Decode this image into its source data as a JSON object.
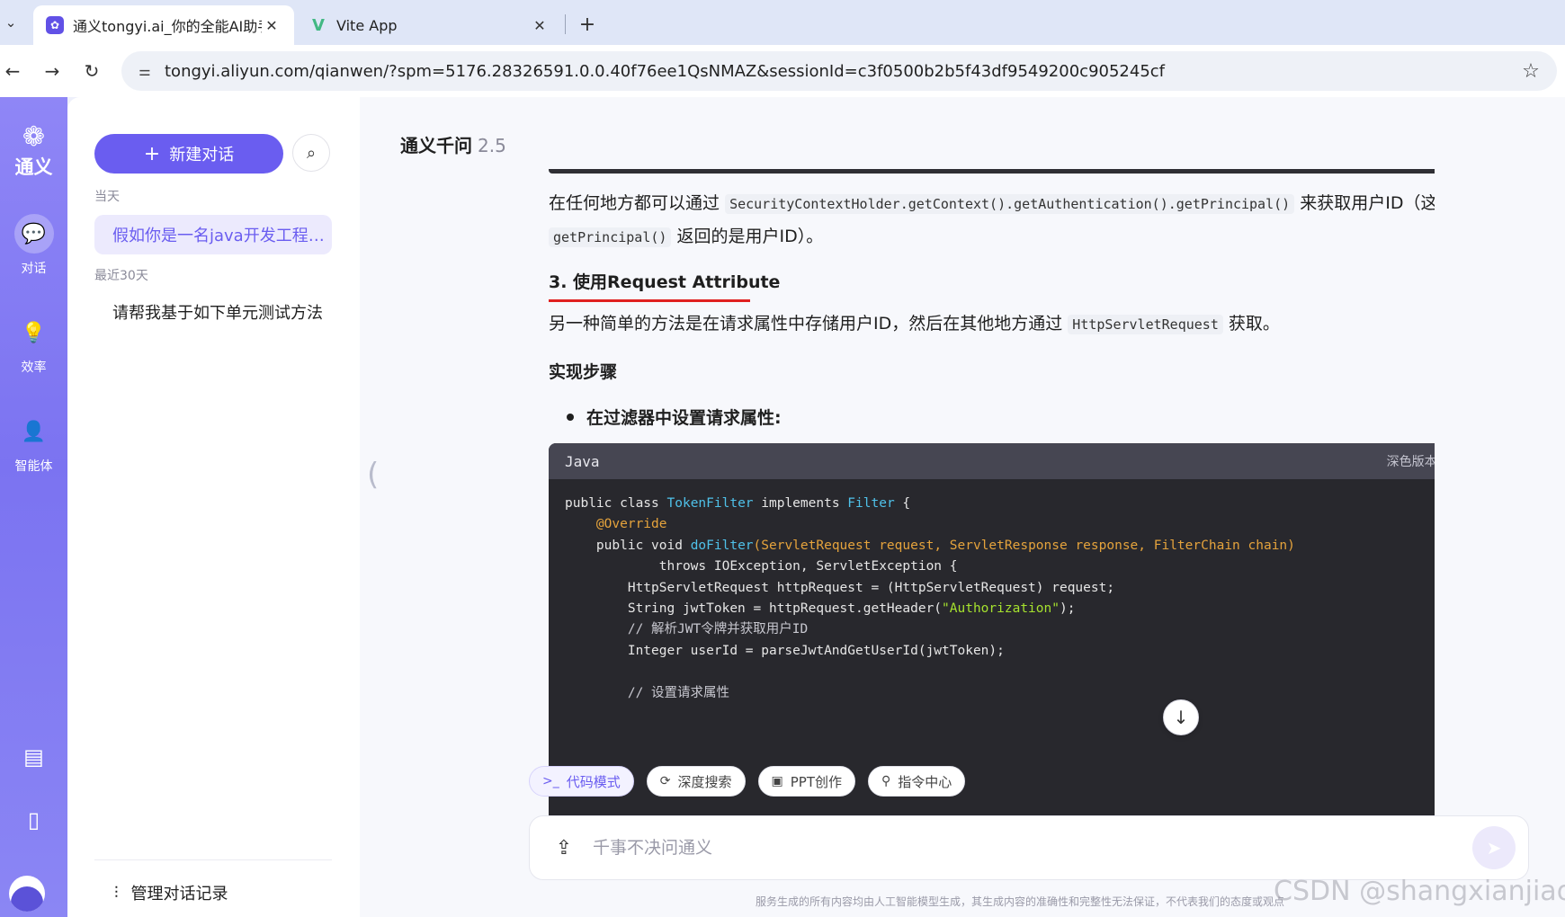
{
  "browser": {
    "tabs": [
      {
        "title": "通义tongyi.ai_你的全能AI助手",
        "close": "✕"
      },
      {
        "title": "Vite App",
        "close": "✕"
      }
    ],
    "new_tab": "+",
    "url": "tongyi.aliyun.com/qianwen/?spm=5176.28326591.0.0.40f76ee1QsNMAZ&sessionId=c3f0500b2b5f43df9549200c905245cf",
    "icons": [
      "tab-list-icon",
      "back-arrow-icon",
      "forward-arrow-icon",
      "reload-icon",
      "site-settings-icon",
      "bookmark-star-icon"
    ]
  },
  "rail": {
    "logo_text": "通义",
    "items": [
      {
        "label": "对话",
        "icon": "chat-bubble-icon",
        "active": true
      },
      {
        "label": "效率",
        "icon": "lightbulb-icon",
        "active": false
      },
      {
        "label": "智能体",
        "icon": "agent-icon",
        "active": false
      }
    ],
    "bottom_icons": [
      "document-icon",
      "tablet-icon",
      "avatar"
    ]
  },
  "sidebar": {
    "new_chat_label": "新建对话",
    "groups": [
      {
        "label": "当天",
        "items": [
          "假如你是一名java开发工程…"
        ]
      },
      {
        "label": "最近30天",
        "items": [
          "请帮我基于如下单元测试方法"
        ]
      }
    ],
    "manage_label": "管理对话记录"
  },
  "main": {
    "model_name": "通义千问",
    "model_version": "2.5",
    "para1": {
      "t1": "在任何地方都可以通过",
      "c1": "SecurityContextHolder.getContext().getAuthentication().getPrincipal()",
      "t2": "来获取用户ID（这里假设",
      "c2": "getPrincipal()",
      "t3": "返回的是用户ID）。"
    },
    "section_heading": "3. 使用Request Attribute",
    "para2": {
      "t1": "另一种简单的方法是在请求属性中存储用户ID，然后在其他地方通过",
      "c1": "HttpServletRequest",
      "t2": "获取。"
    },
    "steps_heading": "实现步骤",
    "bullet": "在过滤器中设置请求属性:",
    "code": {
      "language": "Java",
      "theme_label": "深色版本",
      "lines": [
        "public class TokenFilter implements Filter {",
        "    @Override",
        "    public void doFilter(ServletRequest request, ServletResponse response, FilterChain chain)",
        "            throws IOException, ServletException {",
        "        HttpServletRequest httpRequest = (HttpServletRequest) request;",
        "        String jwtToken = httpRequest.getHeader(\"Authorization\");",
        "        // 解析JWT令牌并获取用户ID",
        "        Integer userId = parseJwtAndGetUserId(jwtToken);",
        "",
        "        // 设置请求属性"
      ]
    },
    "tools": [
      {
        "label": "代码模式",
        "icon": ">_",
        "active": true
      },
      {
        "label": "深度搜索",
        "icon": "⟳",
        "active": false
      },
      {
        "label": "PPT创作",
        "icon": "▣",
        "active": false
      },
      {
        "label": "指令中心",
        "icon": "⚲",
        "active": false
      }
    ],
    "input_placeholder": "千事不决问通义",
    "disclaimer": "服务生成的所有内容均由人工智能模型生成，其生成内容的准确性和完整性无法保证，不代表我们的态度或观点",
    "watermark": "CSDN @shangxianjiao"
  }
}
